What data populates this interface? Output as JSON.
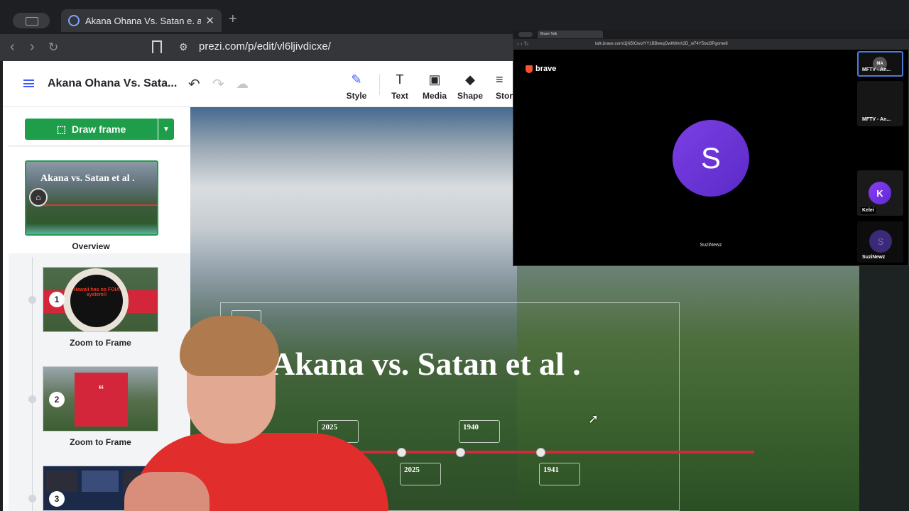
{
  "browser": {
    "tab_title": "Akana Ohana Vs. Satan e. al | P",
    "tab_close": "✕",
    "new_tab": "+",
    "url": "prezi.com/p/edit/vl6ljivdicxe/"
  },
  "prezi": {
    "title": "Akana Ohana Vs. Sata...",
    "toolbar": [
      {
        "label": "Style",
        "icon": "✎"
      },
      {
        "label": "Text",
        "icon": "T"
      },
      {
        "label": "Media",
        "icon": "▣"
      },
      {
        "label": "Shape",
        "icon": "◆"
      },
      {
        "label": "Story",
        "icon": "≡"
      }
    ],
    "draw_frame_label": "Draw frame",
    "draw_frame_dropdown": "▼",
    "overview": {
      "thumb_title": "Akana vs. Satan et al .",
      "label": "Overview"
    },
    "frames": [
      {
        "number": "1",
        "label": "Zoom to Frame",
        "thumb_text": "Hawaii has no FOIA system!!"
      },
      {
        "number": "2",
        "label": "Zoom to Frame",
        "thumb_text": "“"
      },
      {
        "number": "3",
        "label": ""
      }
    ],
    "canvas": {
      "title": "Akana vs. Satan et al .",
      "timeline_cards": [
        {
          "text": "2025"
        },
        {
          "text": "1940"
        },
        {
          "text": "2025"
        },
        {
          "text": "1941"
        }
      ]
    }
  },
  "brave_talk": {
    "tab_title": "Brave Talk",
    "url": "talk.brave.com/1jN5fCwotYY1BBeeqOwltWmh2D_w74Y5txd3Pgome8",
    "logo_text": "brave",
    "main_avatar_letter": "S",
    "main_name": "SuziNewz",
    "tiles": [
      {
        "initials": "MA",
        "label": "MFTV - An..."
      },
      {
        "label": "MFTV - An..."
      },
      {
        "initials": "K",
        "label": "Kelei"
      },
      {
        "initials": "S",
        "label": "SuziNewz"
      }
    ]
  },
  "colors": {
    "accent": "#3d5afe",
    "green": "#1e9e4a",
    "timeline_red": "#d6283b",
    "brave_purple": "#7b3fe4"
  }
}
